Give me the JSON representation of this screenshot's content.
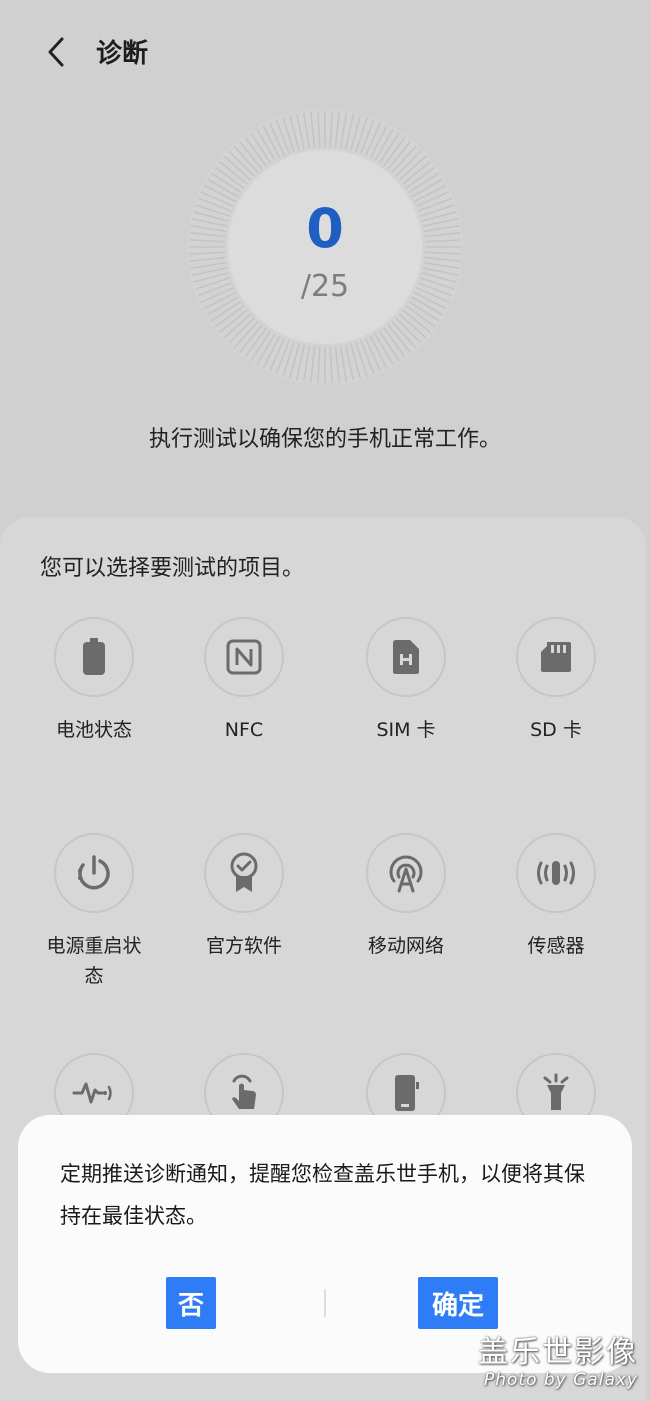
{
  "header": {
    "title": "诊断",
    "back_icon": "chevron-left-icon"
  },
  "dial": {
    "count": "0",
    "total": "/25",
    "progress": 0,
    "accent": "#1f5fc4"
  },
  "intro": "执行测试以确保您的手机正常工作。",
  "panel": {
    "heading": "您可以选择要测试的项目。",
    "items": [
      {
        "label": "电池状态",
        "icon": "battery-icon"
      },
      {
        "label": "NFC",
        "icon": "nfc-icon"
      },
      {
        "label": "SIM 卡",
        "icon": "sim-card-icon"
      },
      {
        "label": "SD 卡",
        "icon": "sd-card-icon"
      },
      {
        "label": "电源重启状态",
        "icon": "power-restart-icon"
      },
      {
        "label": "官方软件",
        "icon": "official-software-icon"
      },
      {
        "label": "移动网络",
        "icon": "mobile-network-icon"
      },
      {
        "label": "传感器",
        "icon": "sensor-icon"
      },
      {
        "label": "",
        "icon": "vibration-icon"
      },
      {
        "label": "",
        "icon": "touch-icon"
      },
      {
        "label": "",
        "icon": "screen-icon"
      },
      {
        "label": "",
        "icon": "flashlight-icon"
      }
    ]
  },
  "dialog": {
    "message": "定期推送诊断通知，提醒您检查盖乐世手机，以便将其保持在最佳状态。",
    "no_label": "否",
    "ok_label": "确定",
    "button_color": "#2f7df6"
  },
  "watermark": {
    "title": "盖乐世影像",
    "subtitle": "Photo by Galaxy"
  }
}
